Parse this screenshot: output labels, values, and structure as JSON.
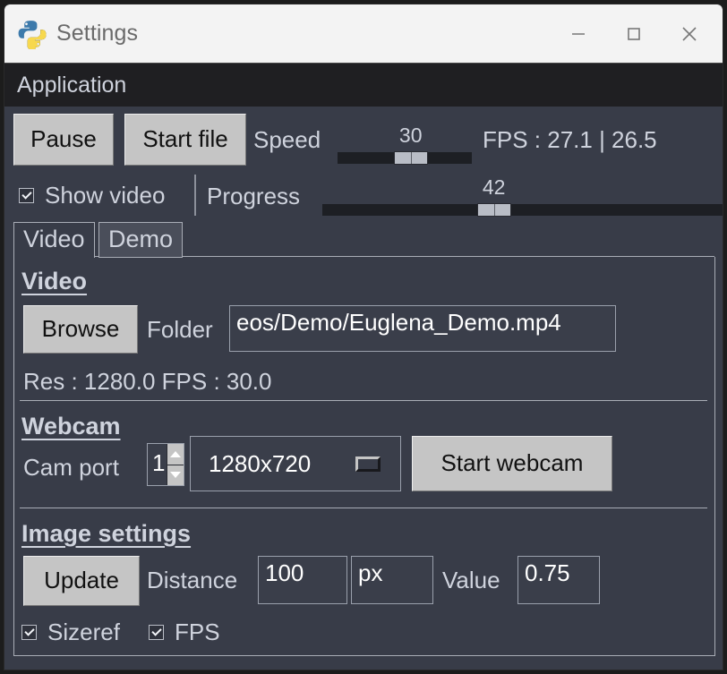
{
  "window": {
    "title": "Settings",
    "app_icon": "python-logo-icon",
    "controls": {
      "minimize": "minimize-icon",
      "maximize": "maximize-icon",
      "close": "close-icon"
    }
  },
  "menubar": {
    "items": [
      "Application"
    ],
    "application_label": "Application"
  },
  "toolbar": {
    "pause_label": "Pause",
    "start_file_label": "Start file",
    "speed_label": "Speed",
    "speed_value": "30",
    "speed_percent": 56,
    "fps_label": "FPS : 27.1 | 26.5"
  },
  "row2": {
    "show_video_label": "Show video",
    "show_video_checked": true,
    "progress_label": "Progress",
    "progress_value": "42",
    "progress_percent": 42
  },
  "tabs": [
    {
      "label": "Video",
      "selected": true
    },
    {
      "label": "Demo",
      "selected": false
    }
  ],
  "panel": {
    "video": {
      "section_title": "Video",
      "browse_label": "Browse",
      "folder_label": "Folder",
      "folder_value": "eos/Demo/Euglena_Demo.mp4",
      "info_label": "Res : 1280.0 FPS : 30.0"
    },
    "webcam": {
      "section_title": "Webcam",
      "cam_port_label": "Cam port",
      "cam_port_value": "1",
      "resolution_value": "1280x720",
      "resolution_options": [
        "1280x720"
      ],
      "start_webcam_label": "Start webcam"
    },
    "image_settings": {
      "section_title": "Image settings",
      "update_label": "Update",
      "distance_label": "Distance",
      "distance_value": "100",
      "unit_value": "px",
      "value_label": "Value",
      "value_value": "0.75",
      "sizeref_label": "Sizeref",
      "sizeref_checked": true,
      "fps_label": "FPS",
      "fps_checked": true
    }
  },
  "colors": {
    "window_background": "#383c48",
    "titlebar_background": "#f3f3f3",
    "menubar_background": "#1f1f22",
    "text": "#cfd3dd",
    "button_face": "#c5c5c5",
    "field_border": "#9aa0ac",
    "slider_groove": "#1d1f24",
    "python_blue": "#3d7aab",
    "python_yellow": "#ffd champ"
  }
}
